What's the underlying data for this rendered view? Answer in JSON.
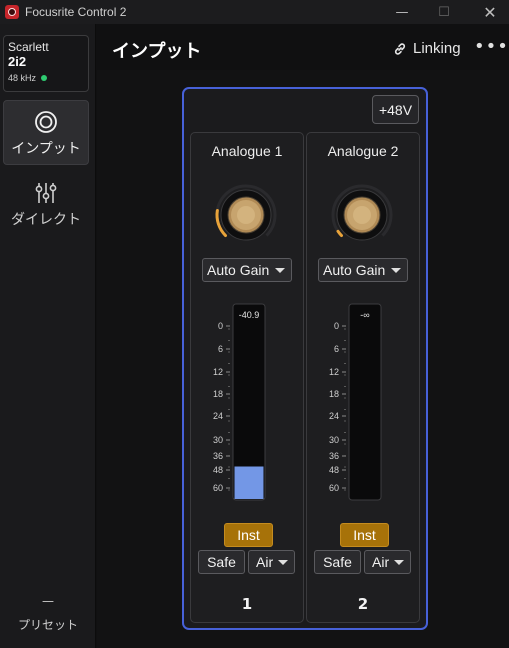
{
  "window": {
    "title": "Focusrite Control 2",
    "minimize_glyph": "—",
    "maximize_glyph": "☐",
    "close_glyph": "✕"
  },
  "device": {
    "brand": "Scarlett",
    "model": "2i2",
    "sample_rate": "48 kHz",
    "status_color": "#2ecc71"
  },
  "sidebar": {
    "items": [
      {
        "label": "インプット",
        "icon": "input-rings-icon",
        "active": true
      },
      {
        "label": "ダイレクト",
        "icon": "sliders-icon",
        "active": false
      }
    ],
    "preset_value": "—",
    "preset_label": "プリセット"
  },
  "header": {
    "title": "インプット",
    "linking_label": "Linking",
    "more_glyph": "•••"
  },
  "group": {
    "phantom_label": "+48V",
    "accent_color": "#4761d8"
  },
  "channels": [
    {
      "name": "Analogue 1",
      "number": "1",
      "gain_mode": "Auto Gain",
      "peak_label": "-40.9",
      "knob_level": 0.2,
      "meter_level_db": -45,
      "inst_label": "Inst",
      "safe_label": "Safe",
      "air_label": "Air"
    },
    {
      "name": "Analogue 2",
      "number": "2",
      "gain_mode": "Auto Gain",
      "peak_label": "-∞",
      "knob_level": 0.04,
      "meter_level_db": null,
      "inst_label": "Inst",
      "safe_label": "Safe",
      "air_label": "Air"
    }
  ],
  "meter_scale": [
    "0",
    "6",
    "12",
    "18",
    "24",
    "30",
    "36",
    "48",
    "60"
  ],
  "colors": {
    "inst_active": "#a77209",
    "knob_ring": "#e8a33a",
    "meter_fill": "#7397e6"
  }
}
